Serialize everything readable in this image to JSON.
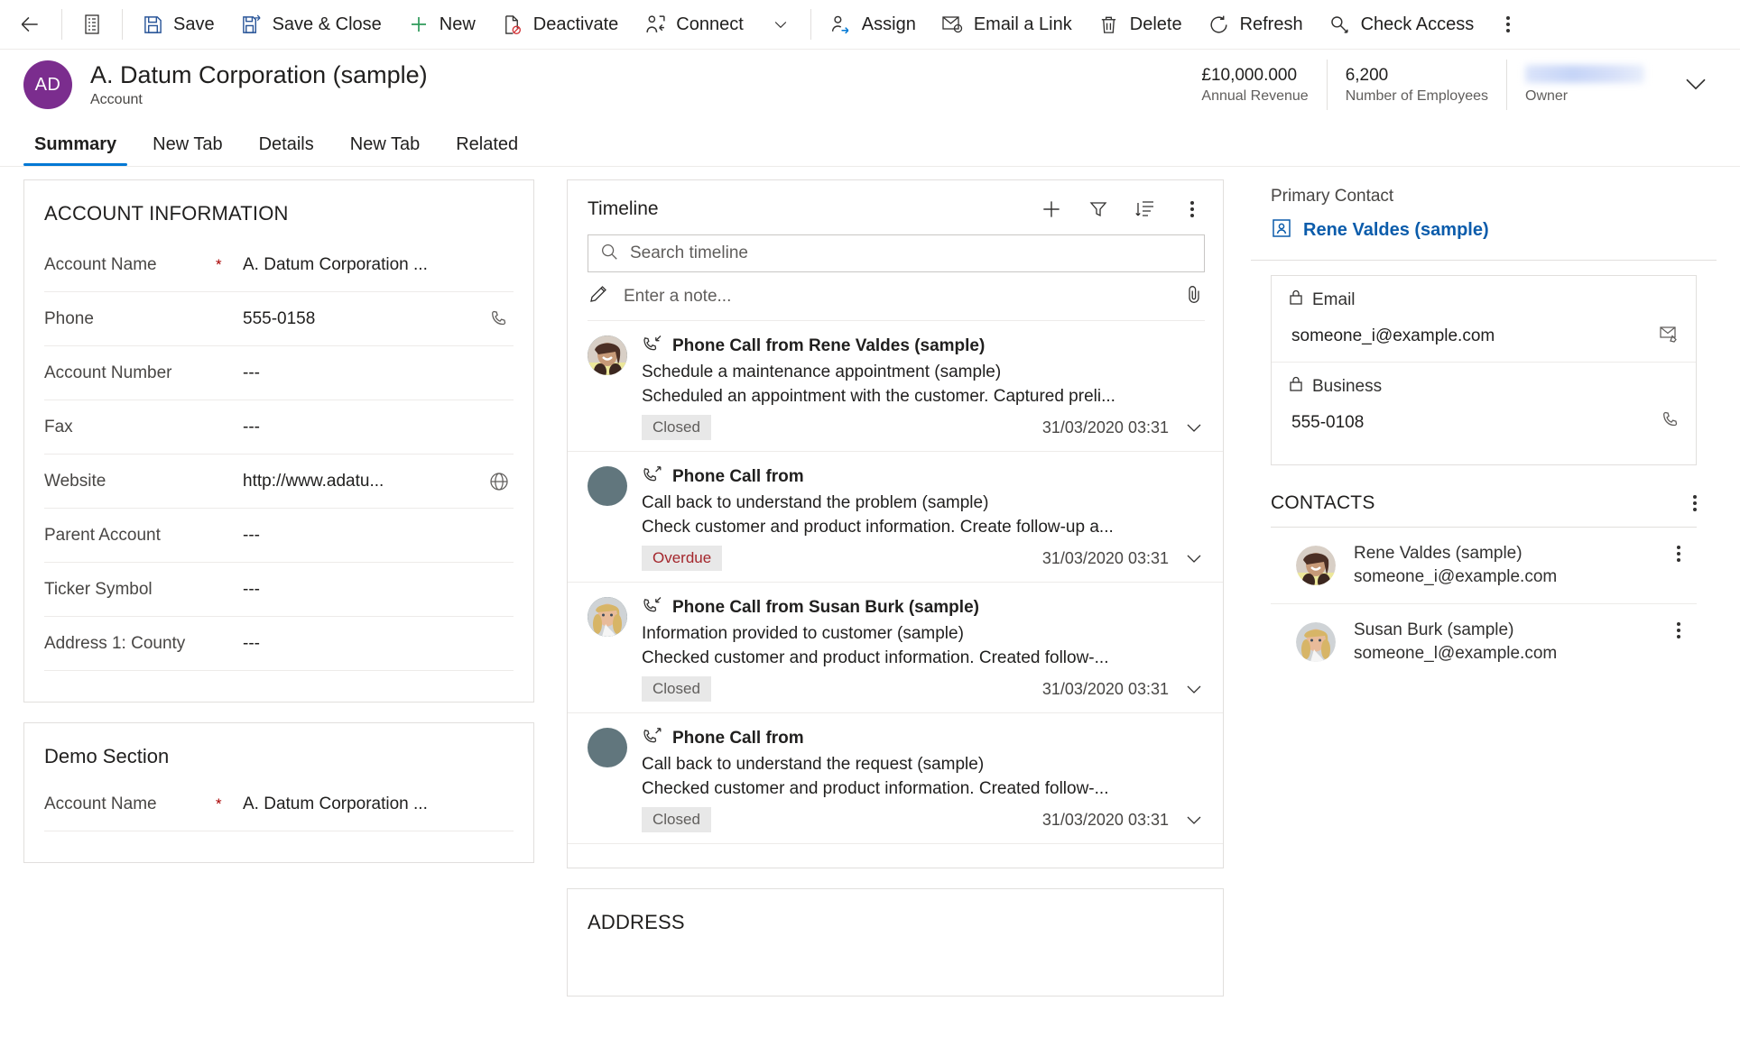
{
  "commandbar": {
    "back_label": "Back",
    "form_selector_label": "Form selector",
    "items": [
      {
        "label": "Save",
        "icon": "save-icon"
      },
      {
        "label": "Save & Close",
        "icon": "save-and-close-icon"
      },
      {
        "label": "New",
        "icon": "plus-icon"
      },
      {
        "label": "Deactivate",
        "icon": "deactivate-icon"
      },
      {
        "label": "Connect",
        "icon": "connect-icon"
      }
    ],
    "items2": [
      {
        "label": "Assign",
        "icon": "assign-icon"
      },
      {
        "label": "Email a Link",
        "icon": "email-link-icon"
      },
      {
        "label": "Delete",
        "icon": "trash-icon"
      },
      {
        "label": "Refresh",
        "icon": "refresh-icon"
      },
      {
        "label": "Check Access",
        "icon": "key-icon"
      }
    ],
    "overflow_label": "More commands"
  },
  "record_header": {
    "avatar_initials": "AD",
    "avatar_color": "#7b2d8e",
    "title": "A. Datum Corporation (sample)",
    "entity": "Account",
    "stats": [
      {
        "value": "£10,000.000",
        "label": "Annual Revenue"
      },
      {
        "value": "6,200",
        "label": "Number of Employees"
      },
      {
        "value": "",
        "label": "Owner",
        "redacted": true
      }
    ],
    "expand_label": "Expand header"
  },
  "tabs": [
    {
      "label": "Summary",
      "active": true
    },
    {
      "label": "New Tab",
      "active": false
    },
    {
      "label": "Details",
      "active": false
    },
    {
      "label": "New Tab",
      "active": false
    },
    {
      "label": "Related",
      "active": false
    }
  ],
  "account_information": {
    "title": "ACCOUNT INFORMATION",
    "fields": [
      {
        "label": "Account Name",
        "required": "*",
        "value": "A. Datum Corporation ...",
        "icon": ""
      },
      {
        "label": "Phone",
        "required": "",
        "value": "555-0158",
        "icon": "phone-icon"
      },
      {
        "label": "Account Number",
        "required": "",
        "value": "---",
        "icon": ""
      },
      {
        "label": "Fax",
        "required": "",
        "value": "---",
        "icon": ""
      },
      {
        "label": "Website",
        "required": "",
        "value": "http://www.adatu...",
        "icon": "globe-icon"
      },
      {
        "label": "Parent Account",
        "required": "",
        "value": "---",
        "icon": ""
      },
      {
        "label": "Ticker Symbol",
        "required": "",
        "value": "---",
        "icon": ""
      },
      {
        "label": "Address 1: County",
        "required": "",
        "value": "---",
        "icon": ""
      }
    ]
  },
  "demo_section": {
    "title": "Demo Section",
    "fields": [
      {
        "label": "Account Name",
        "required": "*",
        "value": "A. Datum Corporation ...",
        "icon": ""
      }
    ]
  },
  "timeline": {
    "title": "Timeline",
    "actions": [
      {
        "name": "create-timeline-record-icon",
        "label": "Create a timeline record"
      },
      {
        "name": "filter-icon",
        "label": "Filter"
      },
      {
        "name": "sort-icon",
        "label": "Sort"
      },
      {
        "name": "more-icon",
        "label": "More commands"
      }
    ],
    "search_placeholder": "Search timeline",
    "search_value": "",
    "note_placeholder": "Enter a note...",
    "attach_label": "Attach file",
    "items": [
      {
        "subject": "Phone Call from Rene Valdes (sample)",
        "direction_icon": "incoming-call-icon",
        "line2": "Schedule a maintenance appointment (sample)",
        "line3": "Scheduled an appointment with the customer. Captured preli...",
        "status": "Closed",
        "status_kind": "closed",
        "time": "31/03/2020 03:31",
        "avatar": "photo-rene"
      },
      {
        "subject": "Phone Call from",
        "direction_icon": "outgoing-call-icon",
        "line2": "Call back to understand the problem (sample)",
        "line3": "Check customer and product information. Create follow-up a...",
        "status": "Overdue",
        "status_kind": "overdue",
        "time": "31/03/2020 03:31",
        "avatar": "placeholder"
      },
      {
        "subject": "Phone Call from Susan Burk (sample)",
        "direction_icon": "incoming-call-icon",
        "line2": "Information provided to customer (sample)",
        "line3": "Checked customer and product information. Created follow-...",
        "status": "Closed",
        "status_kind": "closed",
        "time": "31/03/2020 03:31",
        "avatar": "photo-susan"
      },
      {
        "subject": "Phone Call from",
        "direction_icon": "outgoing-call-icon",
        "line2": "Call back to understand the request (sample)",
        "line3": "Checked customer and product information. Created follow-...",
        "status": "Closed",
        "status_kind": "closed",
        "time": "31/03/2020 03:31",
        "avatar": "placeholder"
      }
    ]
  },
  "address_section": {
    "title": "ADDRESS"
  },
  "right_panel": {
    "primary_contact_label": "Primary Contact",
    "primary_contact_name": "Rene Valdes (sample)",
    "primary_contact_color": "#0b5cab",
    "detail_rows": [
      {
        "label": "Email",
        "lock": true,
        "value": "someone_i@example.com",
        "icon": "email-icon"
      },
      {
        "label": "Business",
        "lock": true,
        "value": "555-0108",
        "icon": "phone-icon"
      }
    ],
    "contacts_title": "CONTACTS",
    "contacts_more_label": "More commands",
    "contacts": [
      {
        "name": "Rene Valdes (sample)",
        "email": "someone_i@example.com",
        "avatar": "photo-rene"
      },
      {
        "name": "Susan Burk (sample)",
        "email": "someone_l@example.com",
        "avatar": "photo-susan"
      }
    ]
  },
  "colors": {
    "accent": "#0078d4",
    "link": "#0b5cab",
    "brand_avatar": "#7b2d8e",
    "overdue": "#a4262c",
    "required": "#a80000",
    "border": "#e1dfdd"
  }
}
